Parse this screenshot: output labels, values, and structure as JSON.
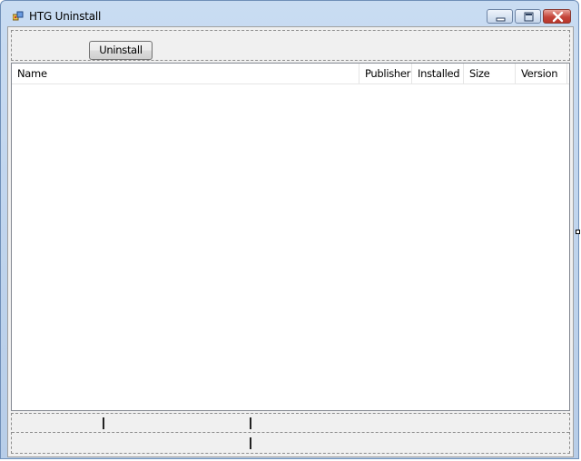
{
  "window": {
    "title": "HTG Uninstall",
    "app_icon": "app-icon",
    "caption_buttons": [
      "minimize-icon",
      "maximize-icon",
      "close-icon"
    ]
  },
  "toolbar": {
    "uninstall_label": "Uninstall"
  },
  "list": {
    "columns": [
      {
        "label": "Name"
      },
      {
        "label": "Publisher"
      },
      {
        "label": "Installed"
      },
      {
        "label": "Size"
      },
      {
        "label": "Version"
      }
    ],
    "rows": []
  },
  "colors": {
    "title_bar": "#c9dcf2",
    "client_background": "#f0f0f0",
    "close_button": "#c4453a"
  }
}
